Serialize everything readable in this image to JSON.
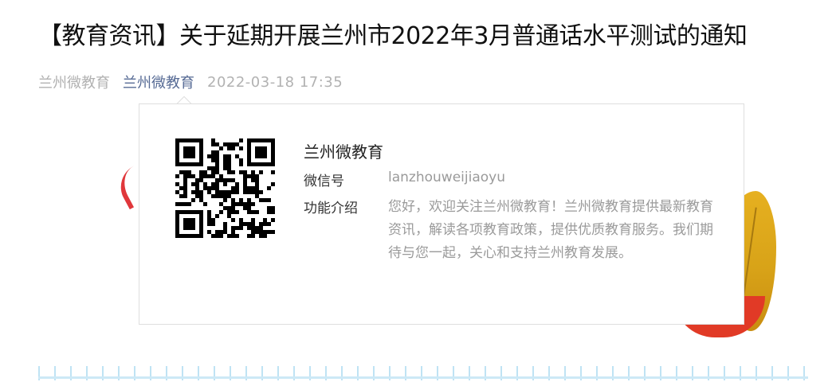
{
  "article": {
    "title": "【教育资讯】关于延期开展兰州市2022年3月普通话水平测试的通知",
    "author": "兰州微教育",
    "account_link": "兰州微教育",
    "date": "2022-03-18 17:35"
  },
  "profile_card": {
    "name": "兰州微教育",
    "wechat_id_label": "微信号",
    "wechat_id": "lanzhouweijiaoyu",
    "intro_label": "功能介绍",
    "intro": "您好，欢迎关注兰州微教育！兰州微教育提供最新教育资讯，解读各项教育政策，提供优质教育服务。我们期待与您一起，关心和支持兰州教育发展。",
    "qr_icon": "qr-code-icon"
  },
  "colors": {
    "link": "#576b95",
    "muted": "#b2b2b2",
    "title": "#111111"
  }
}
